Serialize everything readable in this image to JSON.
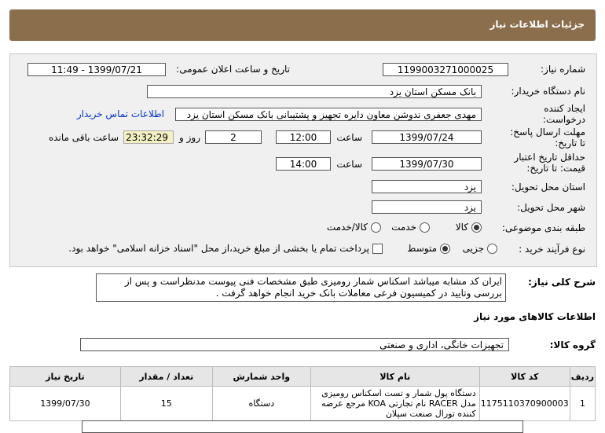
{
  "header": {
    "title": "جزئیات اطلاعات نیاز"
  },
  "fields": {
    "need_number_label": "شماره نیاز:",
    "need_number": "1199003271000025",
    "announce_label": "تاریخ و ساعت اعلان عمومی:",
    "announce_value": "1399/07/21 - 11:49",
    "buyer_label": "نام دستگاه خریدار:",
    "buyer_value": "بانک مسکن استان یزد",
    "creator_label": "ایجاد کننده درخواست:",
    "creator_value": "مهدی  جعفری ندوشن معاون دایره تجهیز و پشتیبانی بانک مسکن استان یزد",
    "contact_link": "اطلاعات تماس خریدار",
    "deadline_label": "مهلت ارسال پاسخ: تا تاریخ:",
    "deadline_date": "1399/07/24",
    "time_label": "ساعت",
    "deadline_time": "12:00",
    "days_value": "2",
    "days_label": "روز و",
    "remaining_time": "23:32:29",
    "remaining_label": "ساعت باقی مانده",
    "validity_label": "حداقل تاریخ اعتبار قیمت: تا تاریخ:",
    "validity_date": "1399/07/30",
    "validity_time": "14:00",
    "province_label": "استان محل تحویل:",
    "province_value": "یزد",
    "city_label": "شهر محل تحویل:",
    "city_value": "یزد",
    "category_label": "طبقه بندی موضوعی:",
    "category_options": [
      "کالا",
      "خدمت",
      "کالا/خدمت"
    ],
    "process_label": "نوع فرآیند خرید :",
    "process_options": [
      "جزیی",
      "متوسط"
    ],
    "payment_note": "پرداخت تمام یا بخشی از مبلغ خرید،از محل \"اسناد خزانه اسلامی\" خواهد بود."
  },
  "description": {
    "label": "شرح کلی نیاز:",
    "text": "ایران کد مشابه میباشد اسکناس شمار رومیزی طبق مشخصات فنی پیوست مدنظراست و پس از بررسی وتایید در کمیسیون فرعی معاملات بانک خرید انجام خواهد گرفت ."
  },
  "goods": {
    "section_title": "اطلاعات کالاهای مورد نیاز",
    "group_label": "گروه کالا:",
    "group_value": "تجهیزات خانگی، اداری و صنعتی",
    "columns": [
      "ردیف",
      "کد کالا",
      "نام کالا",
      "واحد شمارش",
      "تعداد / مقدار",
      "تاریخ نیاز"
    ],
    "rows": [
      {
        "row": "1",
        "code": "1175110370900003",
        "name": "دستگاه پول شمار و تست اسکناس رومیزی مدل RACER نام تجارتی KOA مرجع عرضه کننده تورال صنعت سپلان",
        "unit": "دستگاه",
        "qty": "15",
        "date": "1399/07/30"
      }
    ]
  }
}
